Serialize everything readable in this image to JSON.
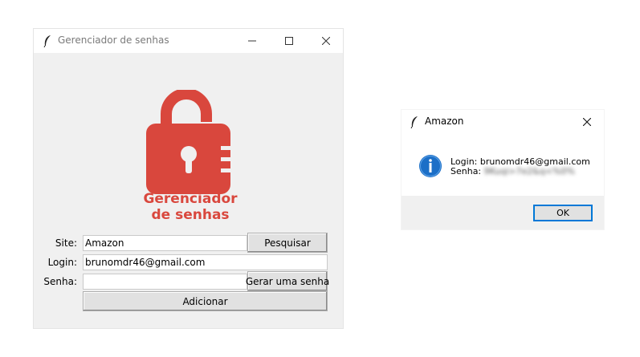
{
  "main_window": {
    "title": "Gerenciador de senhas",
    "logo": {
      "line1": "Gerenciador",
      "line2": "de senhas",
      "color": "#d9473d"
    },
    "form": {
      "site_label": "Site:",
      "site_value": "Amazon",
      "search_button": "Pesquisar",
      "login_label": "Login:",
      "login_value": "brunomdr46@gmail.com",
      "password_label": "Senha:",
      "password_value": "",
      "generate_button": "Gerar uma senha",
      "add_button": "Adicionar"
    }
  },
  "dialog": {
    "title": "Amazon",
    "icon": "info-icon",
    "login_line": "Login: brunomdr46@gmail.com",
    "password_prefix": "Senha:",
    "password_obscured": "9Kuqi>7e2&q<%0%",
    "ok_button": "OK"
  },
  "colors": {
    "accent": "#0078d7",
    "logo": "#d9473d",
    "info_blue": "#1c6fc7"
  }
}
